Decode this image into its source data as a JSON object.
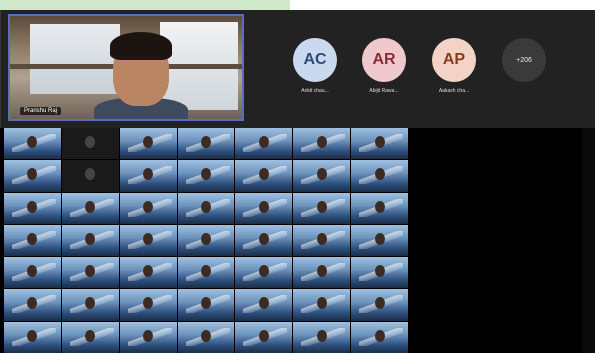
{
  "speaker": {
    "name": "Pranshu Raj"
  },
  "avatars": [
    {
      "initials": "AC",
      "label": "Ankit chau...",
      "bg": "#cbd9ef",
      "fg": "#2d4a7a"
    },
    {
      "initials": "AR",
      "label": "Abijit Rawa...",
      "bg": "#efc9cd",
      "fg": "#8a2d36"
    },
    {
      "initials": "AP",
      "label": "Aakash cha...",
      "bg": "#f2d3c5",
      "fg": "#8c3a1f"
    }
  ],
  "more_count": "+206",
  "gallery": {
    "tiles": [
      {
        "label": "",
        "dark": false
      },
      {
        "label": "",
        "dark": true
      },
      {
        "label": "",
        "dark": false
      },
      {
        "label": "",
        "dark": false
      },
      {
        "label": "",
        "dark": false
      },
      {
        "label": "",
        "dark": false
      },
      {
        "label": "",
        "dark": false
      },
      {
        "label": "",
        "dark": false
      },
      {
        "label": "",
        "dark": true
      },
      {
        "label": "",
        "dark": false
      },
      {
        "label": "",
        "dark": false
      },
      {
        "label": "",
        "dark": false
      },
      {
        "label": "",
        "dark": false
      },
      {
        "label": "",
        "dark": false
      },
      {
        "label": "",
        "dark": false
      },
      {
        "label": "",
        "dark": false
      },
      {
        "label": "",
        "dark": false
      },
      {
        "label": "",
        "dark": false
      },
      {
        "label": "",
        "dark": false
      },
      {
        "label": "",
        "dark": false
      },
      {
        "label": "",
        "dark": false
      },
      {
        "label": "",
        "dark": false
      },
      {
        "label": "",
        "dark": false
      },
      {
        "label": "",
        "dark": false
      },
      {
        "label": "",
        "dark": false
      },
      {
        "label": "",
        "dark": false
      },
      {
        "label": "",
        "dark": false
      },
      {
        "label": "",
        "dark": false
      },
      {
        "label": "",
        "dark": false
      },
      {
        "label": "",
        "dark": false
      },
      {
        "label": "",
        "dark": false
      },
      {
        "label": "",
        "dark": false
      },
      {
        "label": "",
        "dark": false
      },
      {
        "label": "",
        "dark": false
      },
      {
        "label": "",
        "dark": false
      },
      {
        "label": "",
        "dark": false
      },
      {
        "label": "",
        "dark": false
      },
      {
        "label": "",
        "dark": false
      },
      {
        "label": "",
        "dark": false
      },
      {
        "label": "",
        "dark": false
      },
      {
        "label": "",
        "dark": false
      },
      {
        "label": "",
        "dark": false
      },
      {
        "label": "",
        "dark": false
      },
      {
        "label": "",
        "dark": false
      },
      {
        "label": "",
        "dark": false
      },
      {
        "label": "",
        "dark": false
      },
      {
        "label": "",
        "dark": false
      },
      {
        "label": "",
        "dark": false
      },
      {
        "label": "",
        "dark": false
      }
    ]
  }
}
